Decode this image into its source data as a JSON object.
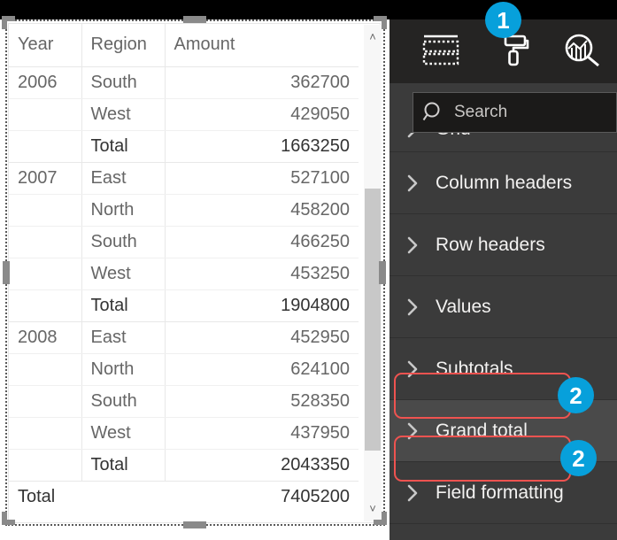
{
  "visual": {
    "type": "matrix-table",
    "columns": [
      "Year",
      "Region",
      "Amount"
    ],
    "rows": [
      {
        "year": "2006",
        "region": "South",
        "amount": "362700",
        "kind": "data"
      },
      {
        "year": "",
        "region": "West",
        "amount": "429050",
        "kind": "data"
      },
      {
        "year": "",
        "region": "Total",
        "amount": "1663250",
        "kind": "subtotal"
      },
      {
        "year": "2007",
        "region": "East",
        "amount": "527100",
        "kind": "data"
      },
      {
        "year": "",
        "region": "North",
        "amount": "458200",
        "kind": "data"
      },
      {
        "year": "",
        "region": "South",
        "amount": "466250",
        "kind": "data"
      },
      {
        "year": "",
        "region": "West",
        "amount": "453250",
        "kind": "data"
      },
      {
        "year": "",
        "region": "Total",
        "amount": "1904800",
        "kind": "subtotal"
      },
      {
        "year": "2008",
        "region": "East",
        "amount": "452950",
        "kind": "data"
      },
      {
        "year": "",
        "region": "North",
        "amount": "624100",
        "kind": "data"
      },
      {
        "year": "",
        "region": "South",
        "amount": "528350",
        "kind": "data"
      },
      {
        "year": "",
        "region": "West",
        "amount": "437950",
        "kind": "data"
      },
      {
        "year": "",
        "region": "Total",
        "amount": "2043350",
        "kind": "subtotal"
      }
    ],
    "grand_total": {
      "label": "Total",
      "amount": "7405200"
    },
    "scrollbar": {
      "up_arrow": "˄",
      "down_arrow": "˅"
    }
  },
  "pane": {
    "tabs": [
      {
        "id": "fields",
        "icon": "fields-table-icon",
        "active": false
      },
      {
        "id": "format",
        "icon": "paint-roller-icon",
        "active": true
      },
      {
        "id": "analytics",
        "icon": "analytics-magnifier-icon",
        "active": false
      }
    ],
    "active_tab_accent": "#f2c811",
    "search": {
      "placeholder": "Search",
      "value": "",
      "icon": "search-icon"
    },
    "items": [
      {
        "label": "Grid",
        "clipped": true,
        "hover": false,
        "highlighted": false
      },
      {
        "label": "Column headers",
        "clipped": false,
        "hover": false,
        "highlighted": false
      },
      {
        "label": "Row headers",
        "clipped": false,
        "hover": false,
        "highlighted": false
      },
      {
        "label": "Values",
        "clipped": false,
        "hover": false,
        "highlighted": false
      },
      {
        "label": "Subtotals",
        "clipped": false,
        "hover": false,
        "highlighted": true
      },
      {
        "label": "Grand total",
        "clipped": false,
        "hover": true,
        "highlighted": true
      },
      {
        "label": "Field formatting",
        "clipped": false,
        "hover": false,
        "highlighted": false
      }
    ],
    "expand_chevron": "›"
  },
  "annotations": {
    "callout_color": "#ef5350",
    "badge_color": "#07a0db",
    "badges": [
      {
        "id": "badge-1",
        "number": "1"
      },
      {
        "id": "badge-2a",
        "number": "2"
      },
      {
        "id": "badge-2b",
        "number": "2"
      }
    ]
  }
}
